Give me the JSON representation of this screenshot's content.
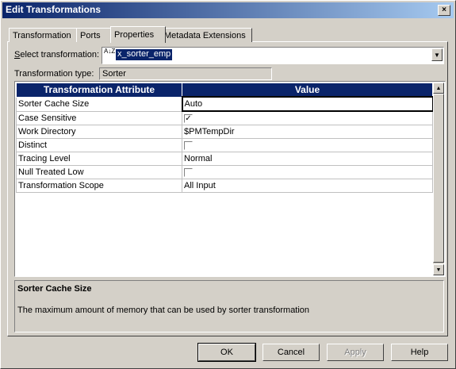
{
  "window": {
    "title": "Edit Transformations",
    "close": "×"
  },
  "tabs": [
    {
      "label": "Transformation"
    },
    {
      "label": "Ports"
    },
    {
      "label": "Properties"
    },
    {
      "label": "Metadata Extensions"
    }
  ],
  "select": {
    "label_prefix": "S",
    "label_rest": "elect transformation:",
    "icon": "A↓Z",
    "value": "x_sorter_emp",
    "arrow": "▼"
  },
  "type": {
    "label": "Transformation type:",
    "value": "Sorter"
  },
  "grid": {
    "headers": [
      "Transformation Attribute",
      "Value"
    ],
    "rows": [
      {
        "attr": "Sorter Cache Size",
        "value": "Auto"
      },
      {
        "attr": "Case Sensitive",
        "value": "",
        "checkbox": true,
        "checked": "✓"
      },
      {
        "attr": "Work Directory",
        "value": "$PMTempDir"
      },
      {
        "attr": "Distinct",
        "value": "",
        "checkbox": true,
        "checked": ""
      },
      {
        "attr": "Tracing Level",
        "value": "Normal"
      },
      {
        "attr": "Null Treated Low",
        "value": "",
        "checkbox": true,
        "checked": ""
      },
      {
        "attr": "Transformation Scope",
        "value": "All Input"
      }
    ],
    "scroll_up": "▲",
    "scroll_down": "▼"
  },
  "description": {
    "title": "Sorter Cache Size",
    "text": "The maximum amount of memory that can be used by sorter transformation"
  },
  "buttons": {
    "ok": "OK",
    "cancel": "Cancel",
    "apply": "Apply",
    "help": "Help"
  }
}
